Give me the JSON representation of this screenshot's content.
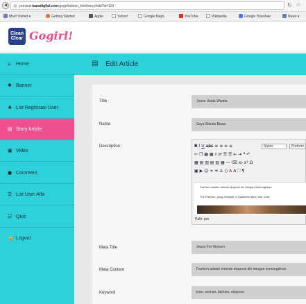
{
  "browser": {
    "url_prefix": "preview.",
    "url_domain": "kanadigital.com",
    "url_path": "/gogirl/admin_html/story/edit?id=119",
    "bookmarks": [
      {
        "label": "Most Visited ▾",
        "icon_color": "#6a7fb5"
      },
      {
        "label": "Getting Started",
        "icon_color": "#e66b2a"
      },
      {
        "label": "Apple",
        "icon_color": "#555555"
      },
      {
        "label": "Yahoo!",
        "icon_color": "#ffffff"
      },
      {
        "label": "Google Maps",
        "icon_color": "#ffffff"
      },
      {
        "label": "YouTube",
        "icon_color": "#d93025"
      },
      {
        "label": "Wikipedia",
        "icon_color": "#ffffff"
      },
      {
        "label": "Google Translate",
        "icon_color": "#4a7cf0"
      },
      {
        "label": "News ▾",
        "icon_color": "#6a7fb5"
      }
    ]
  },
  "header": {
    "logo_line1": "Clean",
    "logo_line2": "Clear",
    "brand": "Gogirl!"
  },
  "sidebar": {
    "items": [
      {
        "label": "Home",
        "icon": "home-icon",
        "glyph": "⌂",
        "active": false
      },
      {
        "label": "Banner",
        "icon": "banner-icon",
        "glyph": "✱",
        "active": false
      },
      {
        "label": "List Registrasi User",
        "icon": "users-icon",
        "glyph": "♣",
        "active": false
      },
      {
        "label": "Story Article",
        "icon": "article-icon",
        "glyph": "▤",
        "active": true
      },
      {
        "label": "Video",
        "icon": "video-icon",
        "glyph": "▣",
        "active": false
      },
      {
        "label": "Comment",
        "icon": "comment-icon",
        "glyph": "●",
        "active": false
      },
      {
        "label": "List User Alfa",
        "icon": "list-icon",
        "glyph": "☰",
        "active": false
      },
      {
        "label": "Quiz",
        "icon": "quiz-icon",
        "glyph": "☷",
        "active": false
      },
      {
        "label": "Logout",
        "icon": "lock-icon",
        "glyph": "🔒",
        "active": false
      }
    ]
  },
  "main": {
    "title": "Edit Article",
    "title_icon": "edit-icon",
    "colors": {
      "accent": "#2ed0d9",
      "active": "#f0508f",
      "brand": "#ec4a8a",
      "logo_bg": "#2c3f8c"
    }
  },
  "form": {
    "title_label": "Title",
    "title_value": "Jeans Untuk Wanita",
    "nama_label": "Nama",
    "nama_value": "Saya Wanita Biasa",
    "description_label": "Description :",
    "meta_title_label": "Meta Title",
    "meta_title_value": "Jeans For Women",
    "meta_content_label": "Meta Content",
    "meta_content_value": "Fashion adalah metode ekspresi diri dengan kemungkinan",
    "keyword_label": "Keyword",
    "keyword_value": "jean, woman, fashion, ekspresi"
  },
  "editor": {
    "styles_select": "Styles",
    "format_select": "Preform",
    "paragraph1": "Fashion adalah metode ekspresi diri dengan kemungkinan",
    "paragraph2": "The Fashion, yang menikah di California tahun lalu, bera",
    "path_text": "Path: pre"
  }
}
